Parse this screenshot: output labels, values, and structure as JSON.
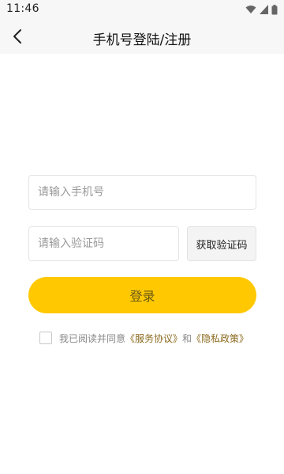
{
  "status_bar": {
    "time": "11:46",
    "icons": [
      "wifi-icon",
      "signal-icon",
      "battery-icon"
    ]
  },
  "nav": {
    "back_icon": "chevron-left-icon",
    "title": "手机号登陆/注册"
  },
  "form": {
    "phone_placeholder": "请输入手机号",
    "phone_value": "",
    "code_placeholder": "请输入验证码",
    "code_value": "",
    "get_code_label": "获取验证码",
    "login_label": "登录"
  },
  "agreement": {
    "checked": false,
    "prefix": "我已阅读并同意",
    "service_link": "《服务协议》",
    "conjunction": "和",
    "privacy_link": "《隐私政策》"
  },
  "colors": {
    "accent": "#ffc800",
    "link": "#8a6a1e",
    "login_text": "#6b5a1a"
  }
}
